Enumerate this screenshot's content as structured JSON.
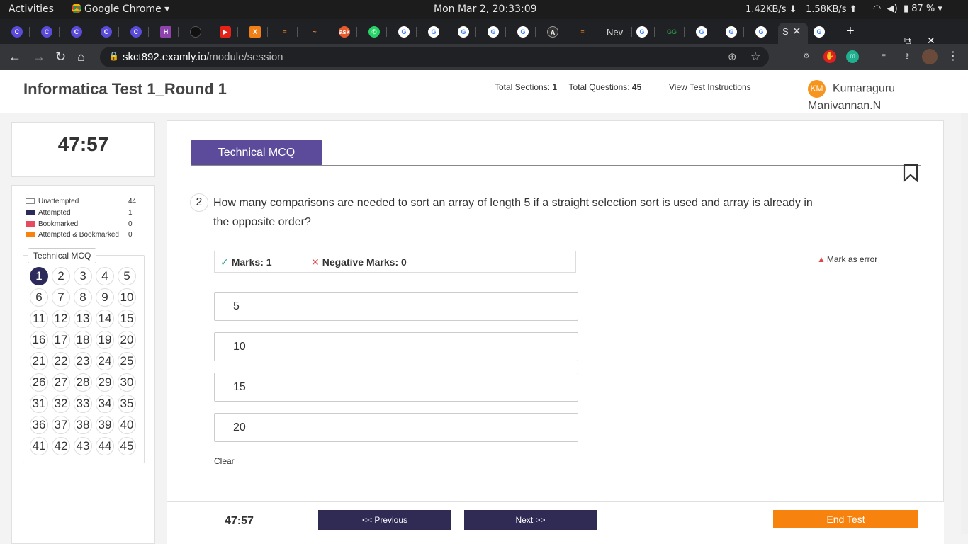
{
  "os": {
    "activities": "Activities",
    "app_name": "Google Chrome ▾",
    "clock": "Mon Mar  2, 20:33:09",
    "net_down": "1.42KB/s ⬇",
    "net_up": "1.58KB/s ⬆",
    "battery": "87 %"
  },
  "browser": {
    "url_host": "skct892.examly.io",
    "url_path": "/module/session",
    "new_tab_label": "Nev"
  },
  "header": {
    "title": "Informatica Test 1_Round 1",
    "total_sections_label": "Total Sections:",
    "total_sections": "1",
    "total_questions_label": "Total Questions:",
    "total_questions": "45",
    "view_instructions": "View Test Instructions",
    "user_initials": "KM",
    "user_name": "Kumaraguru Manivannan.N"
  },
  "sidebar": {
    "timer": "47:57",
    "legend": [
      {
        "label": "Unattempted",
        "count": "44",
        "color": "#ffffff"
      },
      {
        "label": "Attempted",
        "count": "1",
        "color": "#2b2a5a"
      },
      {
        "label": "Bookmarked",
        "count": "0",
        "color": "#e84a5f"
      },
      {
        "label": "Attempted & Bookmarked",
        "count": "0",
        "color": "#f7820d"
      }
    ],
    "section_name": "Technical MCQ",
    "current_question": 1,
    "question_count": 45
  },
  "question": {
    "section_tab": "Technical MCQ",
    "number": "2",
    "text": "How many comparisons are needed to sort an array of length 5 if a straight selection sort is used and array is already in the opposite order?",
    "marks": "Marks: 1",
    "negative_marks": "Negative Marks: 0",
    "mark_error": "Mark as error",
    "options": [
      "5",
      "10",
      "15",
      "20"
    ],
    "clear": "Clear"
  },
  "footer": {
    "timer": "47:57",
    "prev": "<< Previous",
    "next": "Next >>",
    "end": "End Test"
  }
}
